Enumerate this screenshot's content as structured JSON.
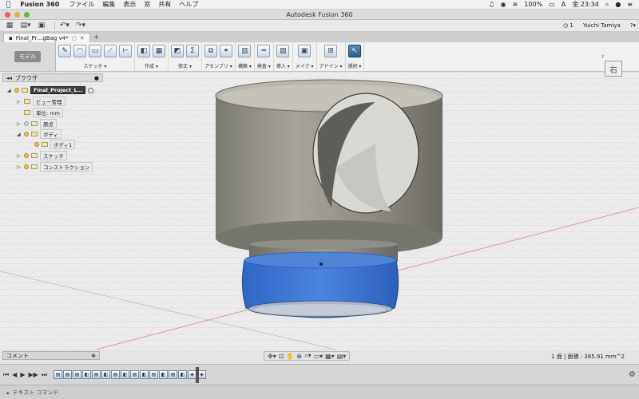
{
  "menubar": {
    "app": "Fusion 360",
    "items": [
      "ファイル",
      "編集",
      "表示",
      "窓",
      "共有",
      "ヘルプ"
    ],
    "battery": "100%",
    "time": "金 23:34"
  },
  "window": {
    "title": "Autodesk Fusion 360"
  },
  "qab": {
    "notifications": "1",
    "user": "Yuichi Tamiya"
  },
  "doc_tab": {
    "label": "Final_Pr…gBag v4*"
  },
  "ribbon": {
    "workspace": "モデル",
    "groups": [
      {
        "label": "スケッチ ▾"
      },
      {
        "label": "作成 ▾"
      },
      {
        "label": "修正 ▾"
      },
      {
        "label": "アセンブリ ▾"
      },
      {
        "label": "構築 ▾"
      },
      {
        "label": "検査 ▾"
      },
      {
        "label": "挿入 ▾"
      },
      {
        "label": "メイク ▾"
      },
      {
        "label": "アドイン ▾"
      },
      {
        "label": "選択 ▾"
      }
    ]
  },
  "viewcube": {
    "face": "右",
    "axis": "Y"
  },
  "browser": {
    "title": "ブラウザ",
    "nodes": [
      {
        "label": "Final_Project_L…"
      },
      {
        "label": "ビュー管理"
      },
      {
        "label": "単位: mm"
      },
      {
        "label": "原点"
      },
      {
        "label": "ボディ"
      },
      {
        "label": "ボディ1"
      },
      {
        "label": "スケッチ"
      },
      {
        "label": "コンストラクション"
      }
    ]
  },
  "comment": {
    "label": "コメント"
  },
  "status": {
    "text": "1 面 | 面積 : 385.91 mm^2"
  },
  "text_command": {
    "label": "テキスト コマンド"
  },
  "colors": {
    "body_gray": "#8b8a80",
    "selected_face": "#3d7ad6",
    "accent": "#2d5f8e"
  }
}
